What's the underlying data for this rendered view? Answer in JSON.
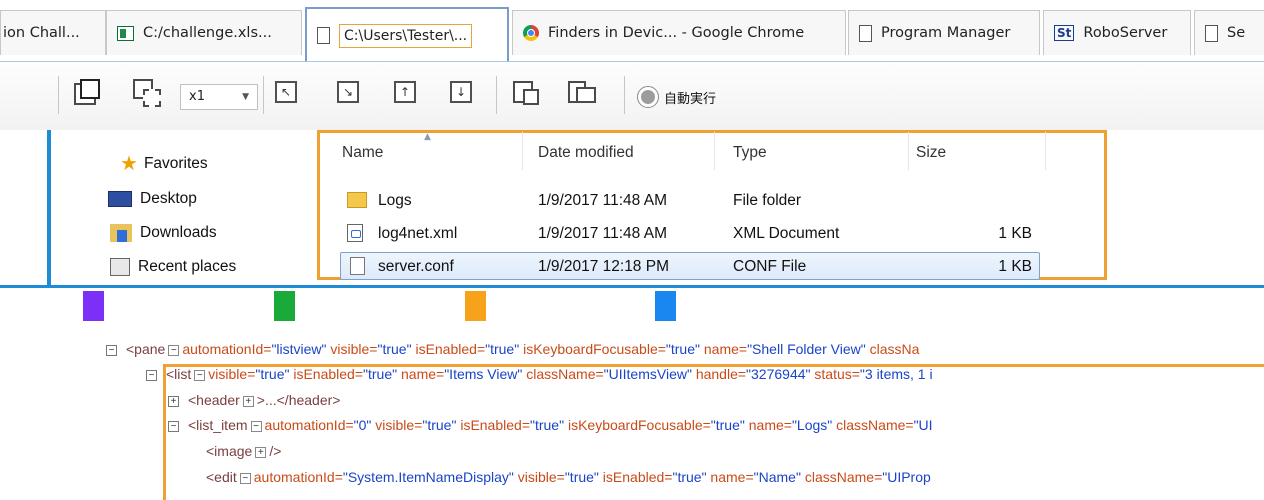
{
  "tabs": [
    {
      "label": "ion Chall...",
      "icon": "document-icon"
    },
    {
      "label": "C:/challenge.xls...",
      "icon": "excel-icon"
    },
    {
      "label": "C:\\Users\\Tester\\...",
      "icon": "document-icon",
      "active": true
    },
    {
      "label": "Finders in Devic... - Google Chrome",
      "icon": "chrome-icon"
    },
    {
      "label": "Program Manager",
      "icon": "document-icon"
    },
    {
      "label": "RoboServer",
      "icon": "st-icon"
    },
    {
      "label": "Se",
      "icon": "document-icon"
    }
  ],
  "toolbar": {
    "speed": "x1",
    "auto_run_label": "自動実行"
  },
  "nav": {
    "items": [
      {
        "label": "Favorites",
        "icon": "star-icon"
      },
      {
        "label": "Desktop",
        "icon": "desktop-icon"
      },
      {
        "label": "Downloads",
        "icon": "downloads-icon"
      },
      {
        "label": "Recent places",
        "icon": "recent-places-icon"
      }
    ]
  },
  "files": {
    "columns": [
      "Name",
      "Date modified",
      "Type",
      "Size"
    ],
    "rows": [
      {
        "name": "Logs",
        "date": "1/9/2017 11:48 AM",
        "type": "File folder",
        "size": "",
        "icon": "folder-icon"
      },
      {
        "name": "log4net.xml",
        "date": "1/9/2017 11:48 AM",
        "type": "XML Document",
        "size": "1 KB",
        "icon": "xml-file-icon"
      },
      {
        "name": "server.conf",
        "date": "1/9/2017 12:18 PM",
        "type": "CONF File",
        "size": "1 KB",
        "icon": "conf-file-icon",
        "selected": true
      }
    ]
  },
  "swatches": [
    "#7b2ff7",
    "#1aaa3a",
    "#f7a21b",
    "#1a86f0"
  ],
  "tree": {
    "line1": {
      "open": "<pane",
      "a1n": "automationId=",
      "a1v": "\"listview\"",
      "a2n": " visible=",
      "a2v": "\"true\"",
      "a3n": " isEnabled=",
      "a3v": "\"true\"",
      "a4n": " isKeyboardFocusable=",
      "a4v": "\"true\"",
      "a5n": " name=",
      "a5v": "\"Shell Folder View\"",
      "a6n": " classNa"
    },
    "line2": {
      "open": "<list",
      "a1n": "visible=",
      "a1v": "\"true\"",
      "a2n": " isEnabled=",
      "a2v": "\"true\"",
      "a3n": " name=",
      "a3v": "\"Items View\"",
      "a4n": " className=",
      "a4v": "\"UIItemsView\"",
      "a5n": " handle=",
      "a5v": "\"3276944\"",
      "a6n": " status=",
      "a6v": "\"3 items, 1 i"
    },
    "line3": {
      "open": "<header",
      "rest": ">...</header>"
    },
    "line4": {
      "open": "<list_item",
      "a1n": "automationId=",
      "a1v": "\"0\"",
      "a2n": " visible=",
      "a2v": "\"true\"",
      "a3n": " isEnabled=",
      "a3v": "\"true\"",
      "a4n": " isKeyboardFocusable=",
      "a4v": "\"true\"",
      "a5n": " name=",
      "a5v": "\"Logs\"",
      "a6n": " className=",
      "a6v": "\"UI"
    },
    "line5": {
      "open": "<image",
      "rest": "/>"
    },
    "line6": {
      "open": "<edit",
      "a1n": "automationId=",
      "a1v": "\"System.ItemNameDisplay\"",
      "a2n": " visible=",
      "a2v": "\"true\"",
      "a3n": " isEnabled=",
      "a3v": "\"true\"",
      "a4n": " name=",
      "a4v": "\"Name\"",
      "a5n": " className=",
      "a5v": "\"UIProp"
    }
  }
}
